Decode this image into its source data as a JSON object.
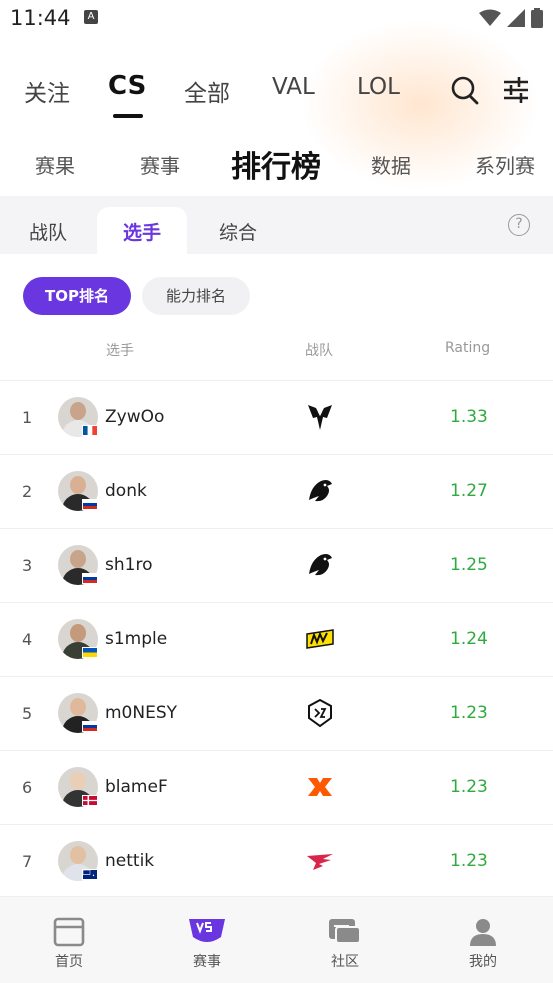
{
  "status_bar": {
    "time": "11:44",
    "badge": "A"
  },
  "top_tabs": [
    "关注",
    "CS",
    "全部",
    "VAL",
    "LOL"
  ],
  "sub_tabs": [
    "赛果",
    "赛事",
    "排行榜",
    "数据",
    "系列赛"
  ],
  "segments": [
    "战队",
    "选手",
    "综合"
  ],
  "pills": [
    "TOP排名",
    "能力排名"
  ],
  "columns": {
    "player": "选手",
    "team": "战队",
    "rating": "Rating"
  },
  "players": [
    {
      "rank": "1",
      "name": "ZywOo",
      "rating": "1.33",
      "flag": "france",
      "team": "vitality"
    },
    {
      "rank": "2",
      "name": "donk",
      "rating": "1.27",
      "flag": "russia",
      "team": "spirit"
    },
    {
      "rank": "3",
      "name": "sh1ro",
      "rating": "1.25",
      "flag": "russia",
      "team": "spirit"
    },
    {
      "rank": "4",
      "name": "s1mple",
      "rating": "1.24",
      "flag": "ukraine",
      "team": "navi"
    },
    {
      "rank": "5",
      "name": "m0NESY",
      "rating": "1.23",
      "flag": "russia",
      "team": "g2"
    },
    {
      "rank": "6",
      "name": "blameF",
      "rating": "1.23",
      "flag": "denmark",
      "team": "fnatic"
    },
    {
      "rank": "7",
      "name": "nettik",
      "rating": "1.23",
      "flag": "australia",
      "team": "falcons"
    }
  ],
  "bottom_nav": [
    "首页",
    "赛事",
    "社区",
    "我的"
  ],
  "colors": {
    "accent": "#6a36e0",
    "rating": "#2eaa3e"
  }
}
